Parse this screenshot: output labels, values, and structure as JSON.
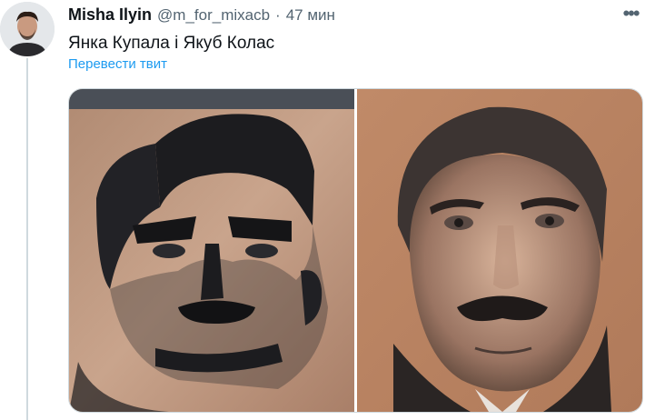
{
  "tweet": {
    "author_name": "Misha Ilyin",
    "handle": "@m_for_mixacb",
    "separator": "·",
    "time": "47 мин",
    "text": "Янка Купала і Якуб Колас",
    "translate_label": "Перевести твит",
    "more_label": "•••"
  },
  "colors": {
    "link": "#1d9bf0",
    "secondary_text": "#536471",
    "primary_text": "#0f1419"
  },
  "icons": {
    "more": "more-horizontal-icon",
    "avatar": "avatar-image"
  },
  "media": {
    "images": [
      {
        "name": "tattoo-left-image"
      },
      {
        "name": "tattoo-right-image"
      }
    ]
  }
}
